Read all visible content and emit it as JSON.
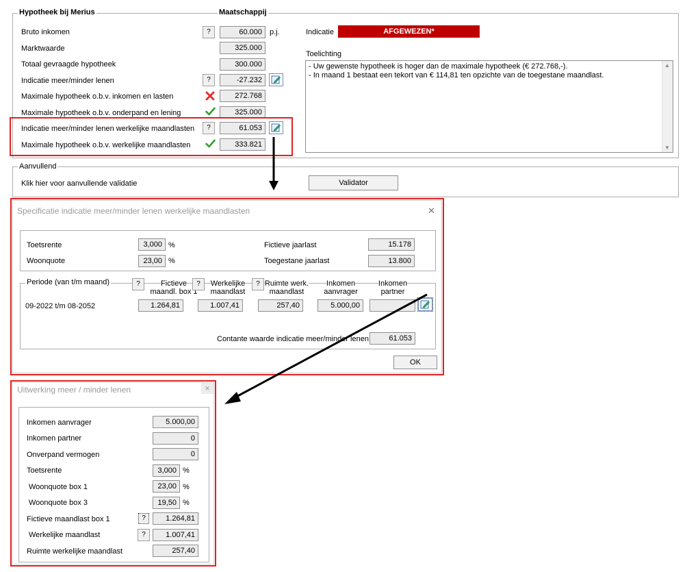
{
  "main": {
    "title_left": "Hypotheek bij Merius",
    "title_right": "Maatschappij",
    "rows": [
      {
        "label": "Bruto inkomen",
        "value": "60.000",
        "unit": "p.j."
      },
      {
        "label": "Marktwaarde",
        "value": "325.000"
      },
      {
        "label": "Totaal gevraagde hypotheek",
        "value": "300.000"
      },
      {
        "label": "Indicatie meer/minder lenen",
        "value": "-27.232"
      },
      {
        "label": "Maximale hypotheek o.b.v. inkomen en lasten",
        "value": "272.768"
      },
      {
        "label": "Maximale hypotheek o.b.v. onderpand en lening",
        "value": "325.000"
      },
      {
        "label": "Indicatie meer/minder lenen werkelijke maandlasten",
        "value": "61.053"
      },
      {
        "label": "Maximale hypotheek o.b.v. werkelijke maandlasten",
        "value": "333.821"
      }
    ],
    "help": "?",
    "indicatie_label": "Indicatie",
    "indicatie_value": "AFGEWEZEN*",
    "toelichting_label": "Toelichting",
    "toelichting_lines": [
      "- Uw gewenste hypotheek is hoger dan de maximale hypotheek (€ 272.768,-).",
      "- In maand 1 bestaat een tekort van € 114,81 ten opzichte van de toegestane maandlast."
    ],
    "status_colors": {
      "rejected": "#c00000",
      "ok": "#2e9e2e",
      "error": "#e03030"
    }
  },
  "aanvullend": {
    "title": "Aanvullend",
    "text": "Klik hier voor aanvullende validatie",
    "button": "Validator"
  },
  "spec": {
    "title": "Specificatie indicatie meer/minder lenen werkelijke maandlasten",
    "close": "✕",
    "toetsrente_label": "Toetsrente",
    "toetsrente": "3,000",
    "woonquote_label": "Woonquote",
    "woonquote": "23,00",
    "pct": "%",
    "fictieve_label": "Fictieve jaarlast",
    "fictieve": "15.178",
    "toegestane_label": "Toegestane jaarlast",
    "toegestane": "13.800",
    "periode_label": "Periode (van t/m maand)",
    "headers": {
      "fictieve_box1": "Fictieve\nmaandl. box 1",
      "werkelijke": "Werkelijke\nmaandlast",
      "ruimte": "Ruimte werk.\nmaandlast",
      "inkomen_aanvrager": "Inkomen\naanvrager",
      "inkomen_partner": "Inkomen\npartner"
    },
    "row": {
      "periode": "09-2022 t/m 08-2052",
      "fictieve_box1": "1.264,81",
      "werkelijke": "1.007,41",
      "ruimte": "257,40",
      "inkomen_aanvrager": "5.000,00",
      "inkomen_partner": ""
    },
    "contante_label": "Contante waarde indicatie meer/minder lenen",
    "contante": "61.053",
    "ok": "OK"
  },
  "uitwerking": {
    "title": "Uitwerking meer / minder lenen",
    "close": "✕",
    "rows": [
      {
        "label": "Inkomen aanvrager",
        "value": "5.000,00"
      },
      {
        "label": "Inkomen partner",
        "value": "0"
      },
      {
        "label": "Onverpand vermogen",
        "value": "0"
      },
      {
        "label": "Toetsrente",
        "value": "3,000",
        "unit": "%"
      },
      {
        "label": "Woonquote box 1",
        "value": "23,00",
        "unit": "%"
      },
      {
        "label": "Woonquote box 3",
        "value": "19,50",
        "unit": "%"
      },
      {
        "label": "Fictieve maandlast box 1",
        "value": "1.264,81"
      },
      {
        "label": "Werkelijke maandlast",
        "value": "1.007,41"
      },
      {
        "label": "Ruimte werkelijke maandlast",
        "value": "257,40"
      }
    ]
  }
}
